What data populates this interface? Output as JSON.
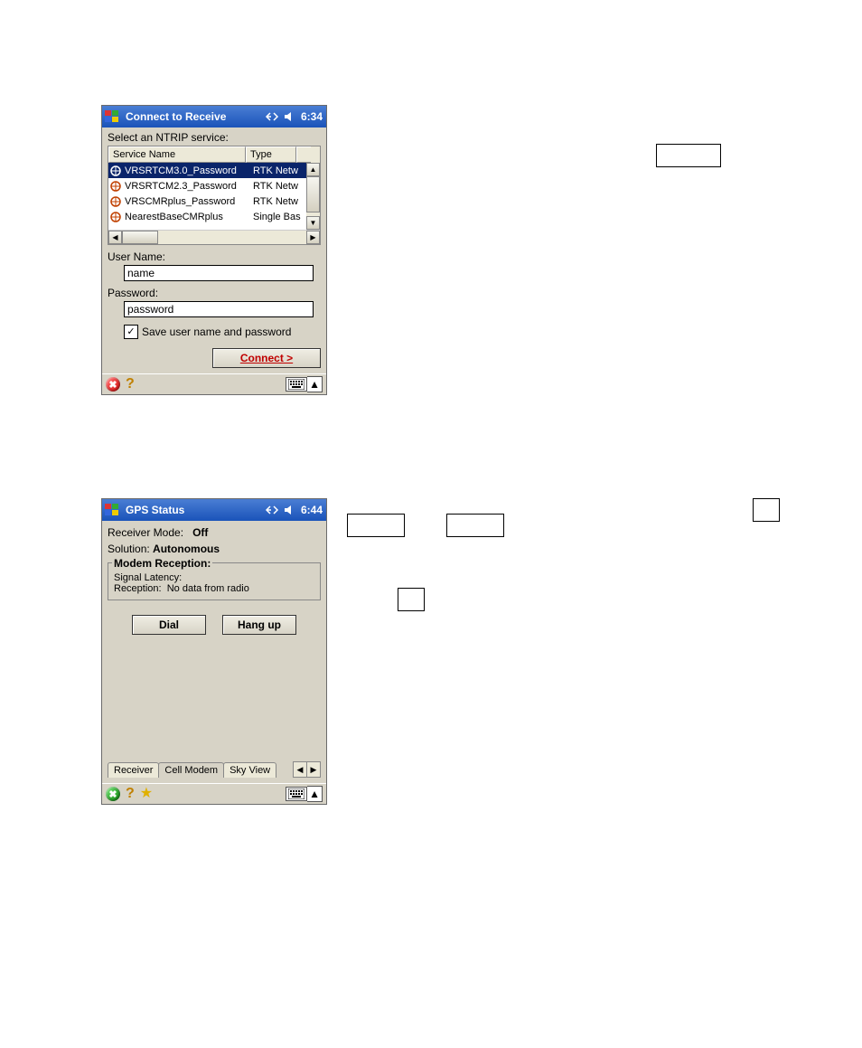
{
  "screen1": {
    "title": "Connect to Receive",
    "time": "6:34",
    "prompt": "Select an NTRIP service:",
    "columns": {
      "name": "Service Name",
      "type": "Type"
    },
    "rows": [
      {
        "name": "VRSRTCM3.0_Password",
        "type": "RTK Netw",
        "selected": true
      },
      {
        "name": "VRSRTCM2.3_Password",
        "type": "RTK Netw",
        "selected": false
      },
      {
        "name": "VRSCMRplus_Password",
        "type": "RTK Netw",
        "selected": false
      },
      {
        "name": "NearestBaseCMRplus",
        "type": "Single Bas",
        "selected": false
      }
    ],
    "username_label": "User Name:",
    "username_value": "name",
    "password_label": "Password:",
    "password_value": "password",
    "save_checked": true,
    "save_label": "Save user name and password",
    "connect_label": "Connect >",
    "close_glyph": "✖",
    "help_glyph": "?"
  },
  "screen2": {
    "title": "GPS Status",
    "time": "6:44",
    "receiver_mode_label": "Receiver Mode:",
    "receiver_mode_value": "Off",
    "solution_label": "Solution:",
    "solution_value": "Autonomous",
    "fieldset_title": "Modem Reception:",
    "latency_label": "Signal Latency:",
    "latency_value": "",
    "reception_label": "Reception:",
    "reception_value": "No data from radio",
    "dial_label": "Dial",
    "hangup_label": "Hang up",
    "tabs": [
      "Receiver",
      "Cell Modem",
      "Sky View"
    ],
    "active_tab": 1,
    "close_glyph": "✖",
    "help_glyph": "?",
    "star_glyph": "★"
  }
}
